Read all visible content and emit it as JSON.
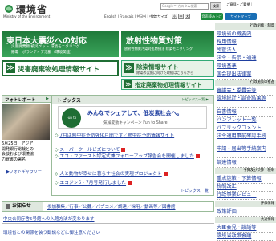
{
  "header": {
    "title": "環境省",
    "subtitle": "Ministry of the Environment",
    "search_placeholder": "Google™ カスタム検索",
    "search_button": "検索",
    "top_links": "｜ご意見・ご要望｜",
    "lang_links": "English | Français | 한국어 | 中文",
    "font_size_label": "文字サイズ",
    "font_sizes": [
      "小",
      "中",
      "大"
    ],
    "voice_button": "音声読み上げ",
    "sitemap_button": "サイトマップ"
  },
  "banners": {
    "quake": {
      "title": "東日本大震災への対応",
      "line1": "災害廃棄物 被災ペット 環境モニタリング",
      "line2": "節電　ボランティア活動（環境関連）"
    },
    "radiation": {
      "title": "放射性物質対策",
      "line1": "放射性物質汚染対処特措法 除染モニタリング"
    },
    "disaster": {
      "icon": "≫",
      "label": "災害廃棄物処理情報サイト"
    },
    "decon": {
      "icon": "≫",
      "label": "除染情報サイト",
      "sub": "除染の実施に向けた取組はこちらから"
    },
    "designated": {
      "icon": "≫",
      "label": "指定廃棄物処理情報サイト"
    }
  },
  "photo_report": {
    "title": "フォトレポート",
    "arrow": "▶",
    "caption_line1": "6月25日　アジア",
    "caption_line2": "開発銀行総裁との",
    "caption_line3": "会談および環境協",
    "caption_line4": "力覚書の署名",
    "gallery_link": "▶フォトギャラリー"
  },
  "topics": {
    "title": "トピックス",
    "list_link": "トピックス一覧 ▶",
    "feature": {
      "badge": "Fun to Share",
      "line1": "みんなでシェアして、低炭素社会へ。",
      "line2": "気候変動キャンペーン Fun to Share"
    },
    "items": [
      {
        "text": "7月は熱中症予防強化月間です",
        "extra": "／熱中症予防情報サイト",
        "new": false
      },
      {
        "text": "スーパークールビズについて",
        "extra": "",
        "new": true
      },
      {
        "text": "エコ・ファースト認定式兼フォローアップ報告会を開催しました",
        "extra": "",
        "new": true
      },
      {
        "text": "人と動物が幸せに暮らす社会の実現プロジェクト",
        "extra": "",
        "new": true
      },
      {
        "text": "エコジン6・7月号発行しました",
        "extra": "",
        "new": true
      }
    ],
    "all_link": "トピックス一覧"
  },
  "notice": {
    "label": "お知らせ",
    "links": "参加募集／行事／公募／パブコメ／調達／採用／動画等／図書館",
    "line1": "中央合同庁舎5号館への入館方法が変わります",
    "line2": "環境省との関係を装う勧誘などに御注意ください"
  },
  "sidebar": {
    "head1": "行政組織・制度",
    "items1": [
      "環境省の概要内",
      "採用情報",
      "所管法人",
      "法令・告示・通達",
      "環境基準",
      "国会提出法律案"
    ],
    "head2": "行政施策の推進",
    "items2": [
      "審議会・委員会等",
      "環境統計・調査結果等",
      "白書情報",
      "パンフレット一覧",
      "パブリックコメント",
      "法令適用事前確認手続",
      "申請・届出等手続案内",
      "調達情報"
    ],
    "head3": "予算及び決算・税制",
    "items3": [
      "重点施策・予算情報",
      "税制改正",
      "行政事業レビュー"
    ],
    "head4": "評価情報",
    "items4": [
      "政策評価"
    ],
    "head5": "共通情報",
    "items5": [
      "大臣会見・談話等",
      "環境省政策会議"
    ]
  }
}
